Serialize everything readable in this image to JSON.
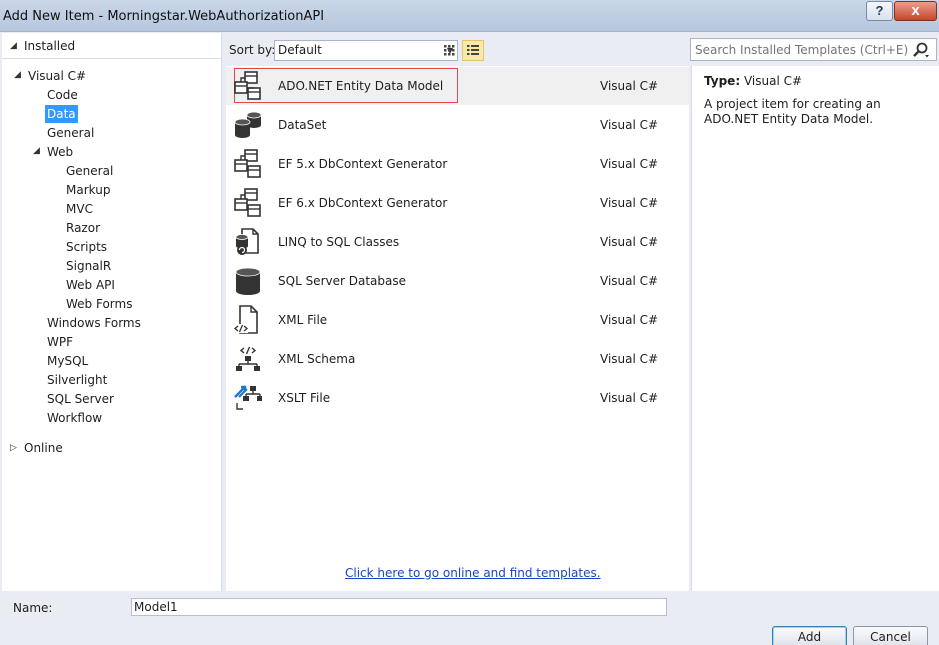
{
  "window": {
    "title": "Add New Item - Morningstar.WebAuthorizationAPI",
    "help_label": "?",
    "close_label": "x"
  },
  "left_panel": {
    "installed": "Installed",
    "online": "Online",
    "tree": [
      {
        "label": "Visual C#",
        "expanded": true
      },
      {
        "label": "Code"
      },
      {
        "label": "Data",
        "selected": true
      },
      {
        "label": "General"
      },
      {
        "label": "Web",
        "expanded": true
      },
      {
        "label": "General"
      },
      {
        "label": "Markup"
      },
      {
        "label": "MVC"
      },
      {
        "label": "Razor"
      },
      {
        "label": "Scripts"
      },
      {
        "label": "SignalR"
      },
      {
        "label": "Web API"
      },
      {
        "label": "Web Forms"
      },
      {
        "label": "Windows Forms"
      },
      {
        "label": "WPF"
      },
      {
        "label": "MySQL"
      },
      {
        "label": "Silverlight"
      },
      {
        "label": "SQL Server"
      },
      {
        "label": "Workflow"
      }
    ]
  },
  "toolbar": {
    "sort_label": "Sort by:",
    "sort_value": "Default",
    "search_placeholder": "Search Installed Templates (Ctrl+E)"
  },
  "templates": [
    {
      "name": "ADO.NET Entity Data Model",
      "lang": "Visual C#",
      "icon": "entity-model-icon",
      "selected": true
    },
    {
      "name": "DataSet",
      "lang": "Visual C#",
      "icon": "dataset-icon"
    },
    {
      "name": "EF 5.x DbContext Generator",
      "lang": "Visual C#",
      "icon": "ef-generator-icon"
    },
    {
      "name": "EF 6.x DbContext Generator",
      "lang": "Visual C#",
      "icon": "ef-generator-icon"
    },
    {
      "name": "LINQ to SQL Classes",
      "lang": "Visual C#",
      "icon": "linq-to-sql-icon"
    },
    {
      "name": "SQL Server Database",
      "lang": "Visual C#",
      "icon": "database-icon"
    },
    {
      "name": "XML File",
      "lang": "Visual C#",
      "icon": "xml-file-icon"
    },
    {
      "name": "XML Schema",
      "lang": "Visual C#",
      "icon": "xml-schema-icon"
    },
    {
      "name": "XSLT File",
      "lang": "Visual C#",
      "icon": "xslt-file-icon"
    }
  ],
  "online_link": "Click here to go online and find templates.",
  "details": {
    "type_label": "Type:",
    "type_value": "Visual C#",
    "description": "A project item for creating an ADO.NET Entity Data Model."
  },
  "bottom": {
    "name_label": "Name:",
    "name_value": "Model1",
    "add_label": "Add",
    "cancel_label": "Cancel"
  },
  "colors": {
    "selection": "#3399ff",
    "link": "#1a46c8",
    "highlight_border": "#e24a4a"
  }
}
